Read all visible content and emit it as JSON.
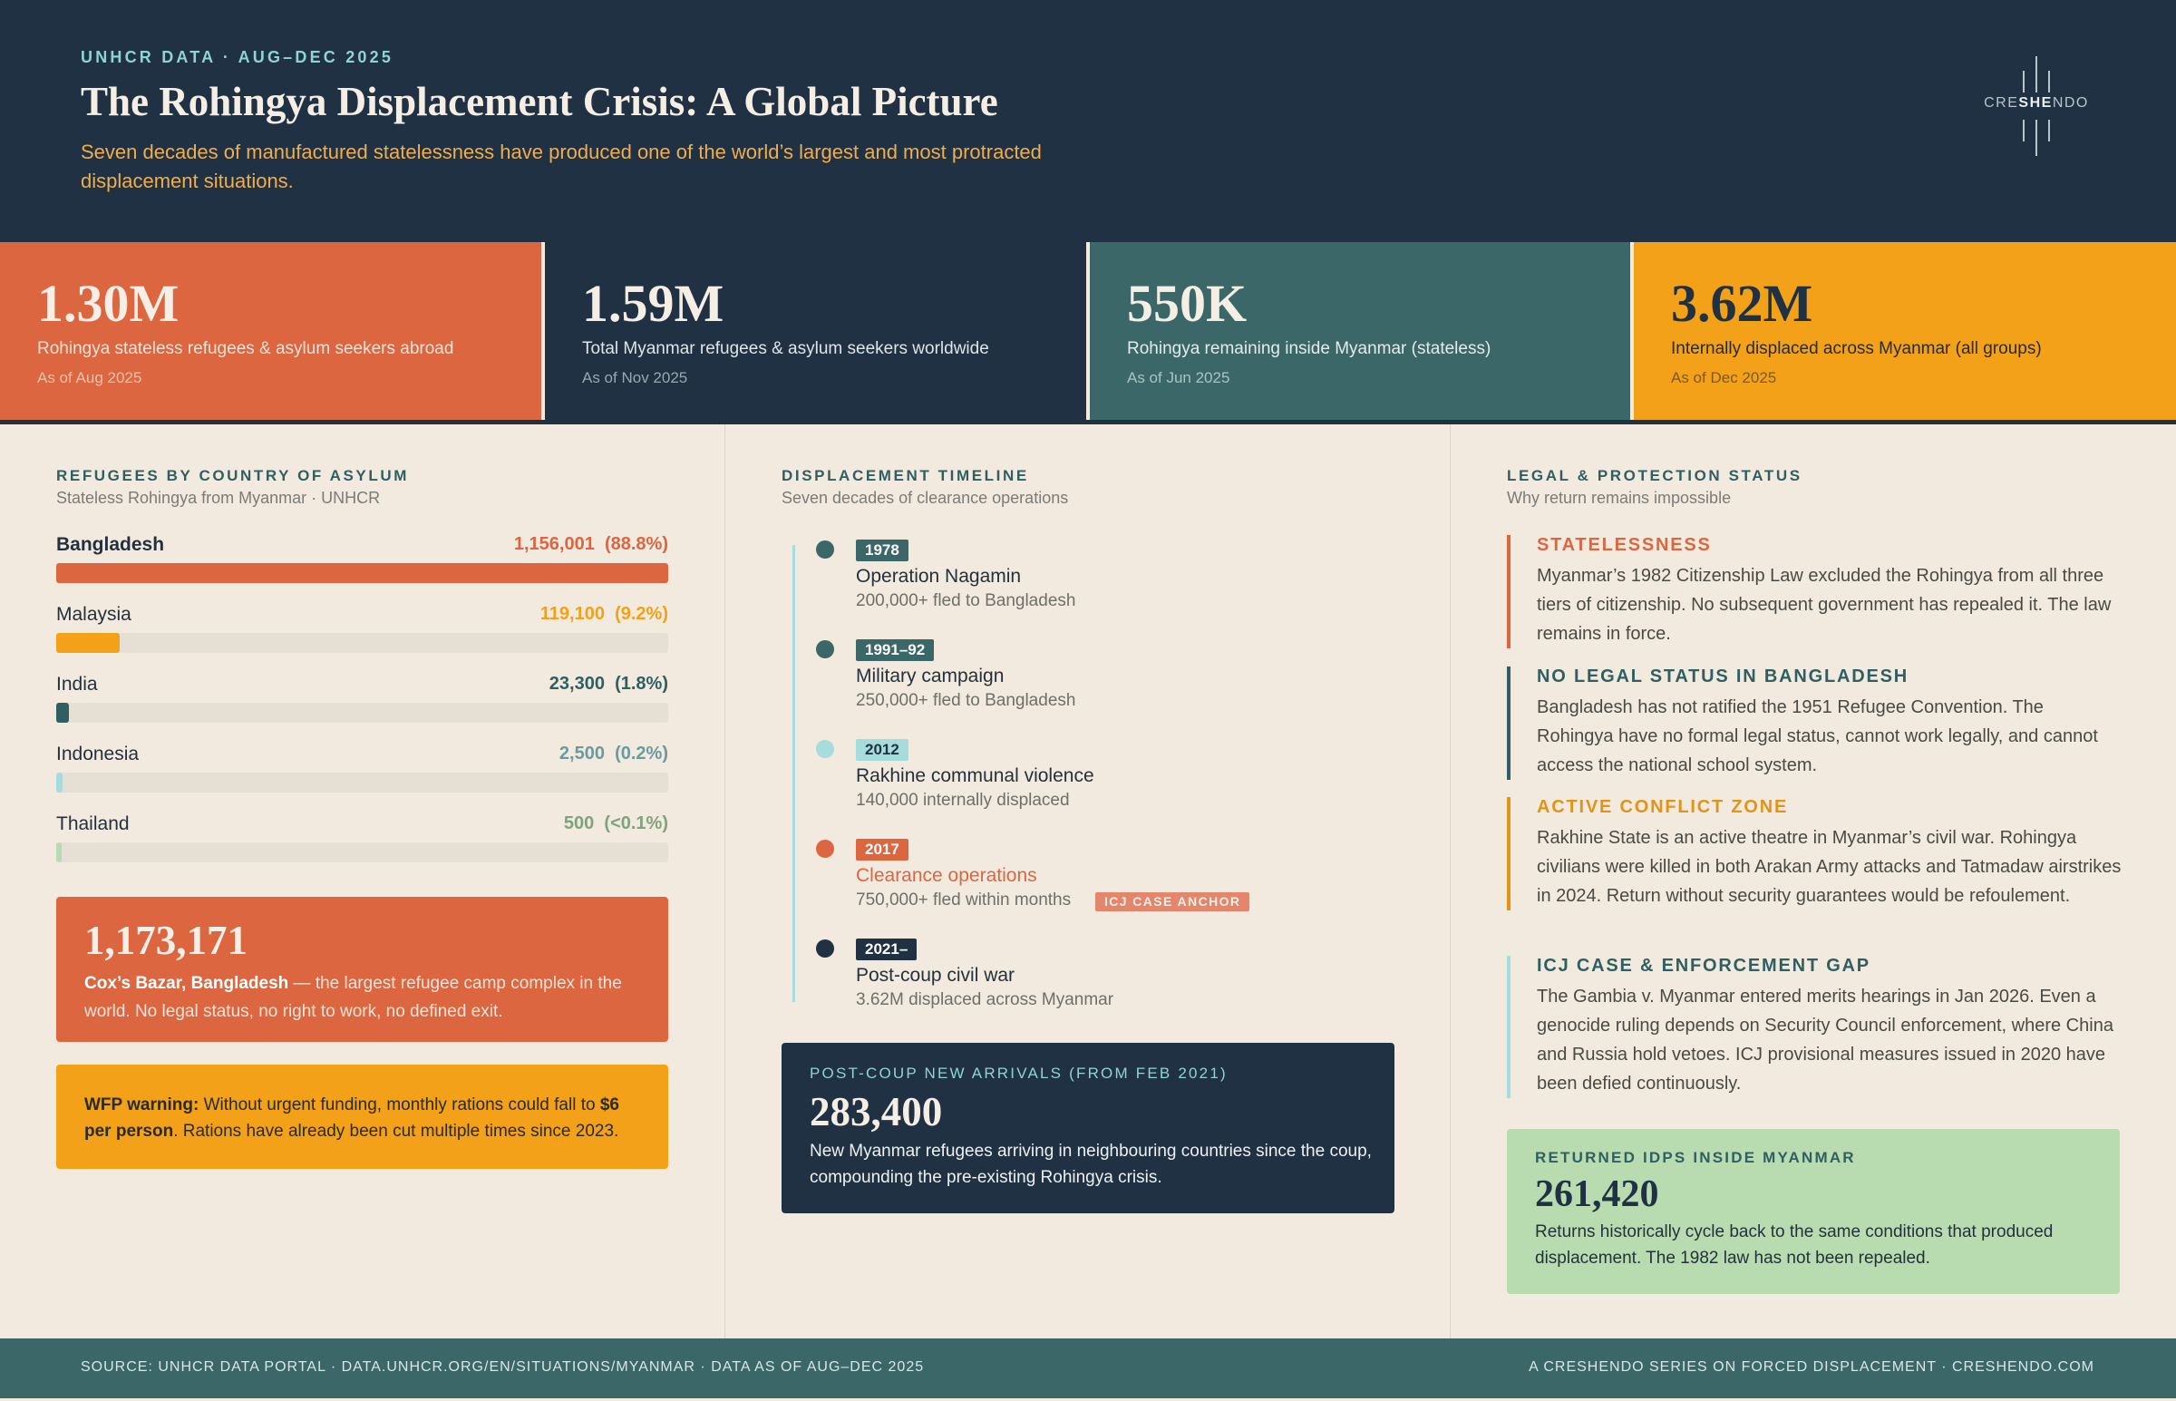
{
  "header": {
    "eyebrow": "UNHCR DATA · AUG–DEC 2025",
    "title": "The Rohingya Displacement Crisis: A Global Picture",
    "subtitle": "Seven decades of manufactured statelessness have produced one of the world’s largest and most protracted displacement situations.",
    "logo_pre": "CRE",
    "logo_mid": "SHE",
    "logo_post": "NDO"
  },
  "kpis": [
    {
      "value": "1.30M",
      "label": "Rohingya stateless refugees & asylum seekers abroad",
      "asof": "As of Aug 2025",
      "bg": "#dc6640"
    },
    {
      "value": "1.59M",
      "label": "Total Myanmar refugees & asylum seekers worldwide",
      "asof": "As of Nov 2025",
      "bg": "#1f3142"
    },
    {
      "value": "550K",
      "label": "Rohingya remaining inside Myanmar (stateless)",
      "asof": "As of Jun 2025",
      "bg": "#3b6769"
    },
    {
      "value": "3.62M",
      "label": "Internally displaced across Myanmar (all groups)",
      "asof": "As of Dec 2025",
      "bg": "#f2a118"
    }
  ],
  "refugees": {
    "title": "REFUGEES BY COUNTRY OF ASYLUM",
    "subtitle": "Stateless Rohingya from Myanmar · UNHCR",
    "rows": [
      {
        "country": "Bangladesh",
        "value": "1,156,001",
        "pct": "(88.8%)",
        "share": 1.0,
        "color": "#dc6640"
      },
      {
        "country": "Malaysia",
        "value": "119,100",
        "pct": "(9.2%)",
        "share": 0.104,
        "color": "#f2a118"
      },
      {
        "country": "India",
        "value": "23,300",
        "pct": "(1.8%)",
        "share": 0.02,
        "color": "#2f5f62"
      },
      {
        "country": "Indonesia",
        "value": "2,500",
        "pct": "(0.2%)",
        "share": 0.01,
        "color": "#a6dcdc",
        "numColor": "#6b9a9d"
      },
      {
        "country": "Thailand",
        "value": "500",
        "pct": "(<0.1%)",
        "share": 0.007,
        "color": "#b9dbb0",
        "numColor": "#7fa27f"
      }
    ],
    "coxs_value": "1,173,171",
    "coxs_bold": "Cox’s Bazar, Bangladesh",
    "coxs_text": " — the largest refugee camp complex in the world. No legal status, no right to work, no defined exit.",
    "wfp_bold": "WFP warning:",
    "wfp_text1": " Without urgent funding, monthly rations could fall to ",
    "wfp_bold2": "$6 per person",
    "wfp_text2": ". Rations have already been cut multiple times since 2023."
  },
  "timeline": {
    "title": "DISPLACEMENT TIMELINE",
    "subtitle": "Seven decades of clearance operations",
    "events": [
      {
        "year": "1978",
        "head": "Operation Nagamin",
        "desc": "200,000+ fled to Bangladesh",
        "color": "#3b6769"
      },
      {
        "year": "1991–92",
        "head": "Military campaign",
        "desc": "250,000+ fled to Bangladesh",
        "color": "#3b6769"
      },
      {
        "year": "2012",
        "head": "Rakhine communal violence",
        "desc": "140,000 internally displaced",
        "color": "#a6dcdc"
      },
      {
        "year": "2017",
        "head": "Clearance operations",
        "desc": "750,000+ fled within months",
        "color": "#dc6640"
      },
      {
        "year": "2021–",
        "head": "Post-coup civil war",
        "desc": "3.62M displaced across Myanmar",
        "color": "#1f3142"
      }
    ],
    "icj_tag": "ICJ CASE ANCHOR",
    "arrivals_eyebrow": "POST-COUP NEW ARRIVALS (FROM FEB 2021)",
    "arrivals_value": "283,400",
    "arrivals_text": "New Myanmar refugees arriving in neighbouring countries since the coup, compounding the pre-existing Rohingya crisis."
  },
  "legal": {
    "title": "LEGAL & PROTECTION STATUS",
    "subtitle": "Why return remains impossible",
    "items": [
      {
        "head": "STATELESSNESS",
        "text": "Myanmar’s 1982 Citizenship Law excluded the Rohingya from all three tiers of citizenship. No subsequent government has repealed it. The law remains in force.",
        "color": "#dc6640"
      },
      {
        "head": "NO LEGAL STATUS IN BANGLADESH",
        "text": "Bangladesh has not ratified the 1951 Refugee Convention. The Rohingya have no formal legal status, cannot work legally, and cannot access the national school system.",
        "color": "#2f5f62"
      },
      {
        "head": "ACTIVE CONFLICT ZONE",
        "text": "Rakhine State is an active theatre in Myanmar’s civil war. Rohingya civilians were killed in both Arakan Army attacks and Tatmadaw airstrikes in 2024. Return without security guarantees would be refoulement.",
        "color": "#e0951a"
      },
      {
        "head": "ICJ CASE & ENFORCEMENT GAP",
        "text": "The Gambia v. Myanmar entered merits hearings in Jan 2026. Even a genocide ruling depends on Security Council enforcement, where China and Russia hold vetoes. ICJ provisional measures issued in 2020 have been defied continuously.",
        "color": "#a6dcdc",
        "headColor": "#2f5f62"
      }
    ],
    "idp_eyebrow": "RETURNED IDPS INSIDE MYANMAR",
    "idp_value": "261,420",
    "idp_text": "Returns historically cycle back to the same conditions that produced displacement. The 1982 law has not been repealed."
  },
  "footer": {
    "left": "SOURCE: UNHCR DATA PORTAL · DATA.UNHCR.ORG/EN/SITUATIONS/MYANMAR · DATA AS OF AUG–DEC 2025",
    "right": "A CRESHENDO SERIES ON FORCED DISPLACEMENT · CRESHENDO.COM"
  }
}
